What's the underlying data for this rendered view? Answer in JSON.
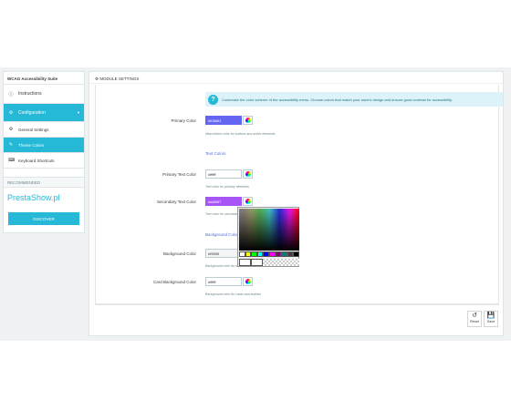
{
  "sidebar": {
    "title": "WCAG Accessibility Suite",
    "items": [
      {
        "label": "Instructions",
        "icon": "info-icon"
      },
      {
        "label": "Configuration",
        "icon": "gears-icon"
      }
    ],
    "sub_items": [
      {
        "label": "General Settings",
        "icon": "gear-icon"
      },
      {
        "label": "Theme Colors",
        "icon": "brush-icon"
      },
      {
        "label": "Keyboard Shortcuts",
        "icon": "keyboard-icon"
      }
    ]
  },
  "recommended": {
    "header": "RECOMMENDED",
    "brand": "PrestaShow.pl",
    "button": "DISCOVER"
  },
  "panel": {
    "title": "MODULE SETTINGS",
    "info": "Customize the color scheme of the accessibility menu. Choose colors that match your store's design and ensure good contrast for accessibility.",
    "fields": {
      "primary_color": {
        "label": "Primary Color",
        "value": "#6366f1",
        "help": "Main theme color for buttons and active elements"
      },
      "primary_text_color": {
        "label": "Primary Text Color",
        "value": "#ffffff",
        "help": "Text color for primary elements"
      },
      "secondary_text_color": {
        "label": "Secondary Text Color",
        "value": "#a855f7",
        "help": "Text color for secondary"
      },
      "background_color": {
        "label": "Background Color",
        "value": "#f5f5f5",
        "help": "Background color for menu container"
      },
      "card_background_color": {
        "label": "Card Background Color",
        "value": "#ffffff",
        "help": "Background color for cards and buttons"
      }
    },
    "sections": {
      "text_colors": "Text Colors",
      "background_colors": "Background Colors"
    },
    "buttons": {
      "reset": "Reset",
      "save": "Save"
    }
  },
  "colors": {
    "accent": "#25b9d7",
    "primary_swatch": "#6366f1",
    "secondary_swatch": "#a855f7"
  },
  "picker_swatches": [
    "#ffffff",
    "#ffff00",
    "#00ff00",
    "#00ffff",
    "#0000ff",
    "#ff00ff",
    "#800080",
    "#008080",
    "#404040",
    "#000000"
  ]
}
